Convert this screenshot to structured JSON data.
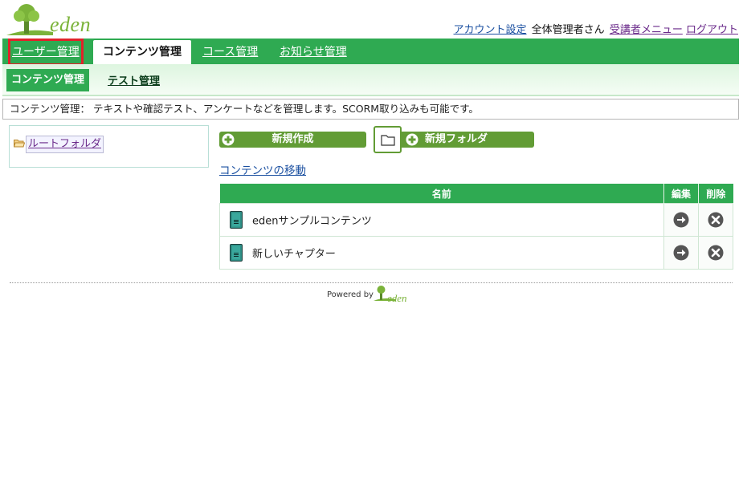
{
  "header": {
    "logo_text": "eden",
    "account_settings": "アカウント設定",
    "user_name": "全体管理者さん",
    "student_menu": "受講者メニュー",
    "logout": "ログアウト"
  },
  "main_nav": {
    "tabs": [
      {
        "label": "ユーザー管理",
        "active": false
      },
      {
        "label": "コンテンツ管理",
        "active": true
      },
      {
        "label": "コース管理",
        "active": false
      },
      {
        "label": "お知らせ管理",
        "active": false
      }
    ]
  },
  "sub_nav": {
    "tabs": [
      {
        "label": "コンテンツ管理",
        "active": true
      },
      {
        "label": "テスト管理",
        "active": false
      }
    ]
  },
  "description": "コンテンツ管理： テキストや確認テスト、アンケートなどを管理します。SCORM取り込みも可能です。",
  "tree": {
    "root_label": "ルートフォルダ"
  },
  "actions": {
    "new_label": "新規作成",
    "new_folder_label": "新規フォルダ",
    "move_link": "コンテンツの移動"
  },
  "table": {
    "headers": {
      "name": "名前",
      "edit": "編集",
      "delete": "削除"
    },
    "rows": [
      {
        "name": "edenサンプルコンテンツ"
      },
      {
        "name": "新しいチャプター"
      }
    ]
  },
  "footer": {
    "powered_by": "Powered by",
    "logo_text": "eden"
  },
  "colors": {
    "nav_green": "#2faa52",
    "button_green": "#629c35",
    "highlight_red": "#e0232a"
  }
}
